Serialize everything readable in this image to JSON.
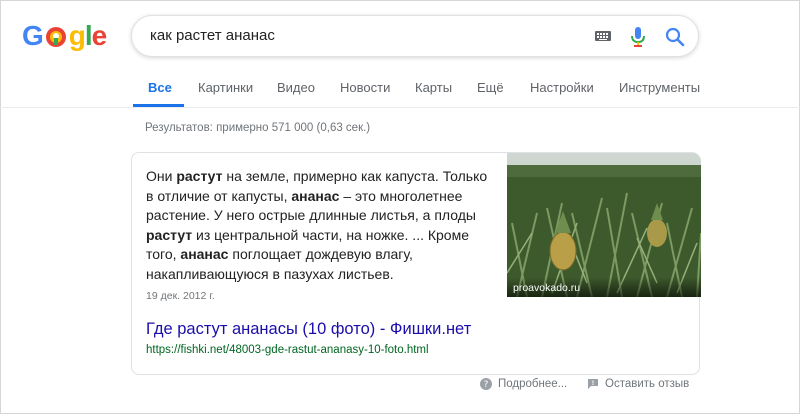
{
  "search": {
    "query": "как растет ананас"
  },
  "logo": {
    "text_g": "G",
    "text_g2": "g",
    "text_l": "l",
    "text_e": "e"
  },
  "icons": {
    "keyboard": "keyboard-icon",
    "mic": "mic-icon",
    "search": "search-icon",
    "help": "help-icon",
    "feedback": "feedback-icon"
  },
  "tabs": [
    {
      "label": "Все",
      "active": true
    },
    {
      "label": "Картинки"
    },
    {
      "label": "Видео"
    },
    {
      "label": "Новости"
    },
    {
      "label": "Карты"
    },
    {
      "label": "Ещё"
    },
    {
      "label": "Настройки"
    },
    {
      "label": "Инструменты"
    }
  ],
  "results_count": "Результатов: примерно 571 000 (0,63 сек.)",
  "snippet": {
    "segments": [
      {
        "t": "Они ",
        "b": false
      },
      {
        "t": "растут",
        "b": true
      },
      {
        "t": " на земле, примерно как капуста. Только в отличие от капусты, ",
        "b": false
      },
      {
        "t": "ананас",
        "b": true
      },
      {
        "t": " – это многолетнее растение. У него острые длинные листья, а плоды ",
        "b": false
      },
      {
        "t": "растут",
        "b": true
      },
      {
        "t": " из центральной части, на ножке. ... Кроме того, ",
        "b": false
      },
      {
        "t": "ананас",
        "b": true
      },
      {
        "t": " поглощает дождевую влагу, накапливающуюся в пазухах листьев.",
        "b": false
      }
    ],
    "date": "19 дек. 2012 г.",
    "image_source": "proavokado.ru",
    "title": "Где растут ананасы (10 фото) - Фишки.нет",
    "url": "https://fishki.net/48003-gde-rastut-ananasy-10-foto.html"
  },
  "footer": {
    "more_label": "Подробнее...",
    "feedback_label": "Оставить отзыв"
  },
  "colors": {
    "accent": "#1a73e8",
    "link": "#1a0dab",
    "url": "#006621",
    "muted": "#70757a"
  }
}
